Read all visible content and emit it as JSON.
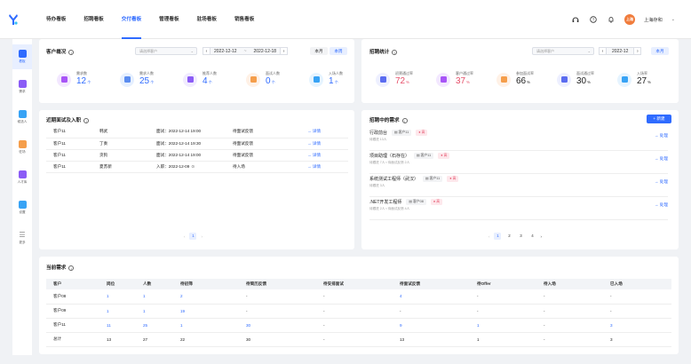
{
  "nav": {
    "tabs": [
      "待办看板",
      "招聘看板",
      "交付看板",
      "管理看板",
      "驻场看板",
      "销售看板"
    ],
    "active_index": 2,
    "user_avatar": "上海",
    "user_name": "上海存和"
  },
  "sidebar": {
    "items": [
      {
        "label": "看板",
        "color": "#2f6bff",
        "active": true
      },
      {
        "label": "需求",
        "color": "#8b5cf6"
      },
      {
        "label": "候选人",
        "color": "#38a3f5"
      },
      {
        "label": "驻场",
        "color": "#f59e4b"
      },
      {
        "label": "人才库",
        "color": "#8b5cf6"
      },
      {
        "label": "设置",
        "color": "#38a3f5"
      },
      {
        "label": "更多",
        "color": "#888"
      }
    ]
  },
  "customer_overview": {
    "title": "客户概况",
    "select_placeholder": "请选择客户",
    "date_start": "2022-12-12",
    "date_sep": "~",
    "date_end": "2022-12-18",
    "btn_month": "本月",
    "btn_week": "本周",
    "stats": [
      {
        "label": "需求数",
        "value": "12",
        "unit": "个",
        "icon_bg": "#f3e8ff",
        "icon_fg": "#a855f7"
      },
      {
        "label": "需求人数",
        "value": "25",
        "unit": "个",
        "icon_bg": "#e6f0ff",
        "icon_fg": "#5b8cf0"
      },
      {
        "label": "推荐人数",
        "value": "4",
        "unit": "个",
        "icon_bg": "#f1ecff",
        "icon_fg": "#8b5cf6"
      },
      {
        "label": "面试人数",
        "value": "0",
        "unit": "个",
        "icon_bg": "#fff1e6",
        "icon_fg": "#f59e4b"
      },
      {
        "label": "入场人数",
        "value": "1",
        "unit": "个",
        "icon_bg": "#e6f4ff",
        "icon_fg": "#38a3f5"
      }
    ]
  },
  "recruit_stats": {
    "title": "招聘统计",
    "select_placeholder": "请选择客户",
    "month": "2022-12",
    "btn_month": "本月",
    "stats": [
      {
        "label": "初筛通过率",
        "value": "72",
        "unit": "%",
        "style": "red",
        "icon_bg": "#eef0ff",
        "icon_fg": "#5b6cf0"
      },
      {
        "label": "客户通过率",
        "value": "37",
        "unit": "%",
        "style": "red",
        "icon_bg": "#f3e8ff",
        "icon_fg": "#a855f7"
      },
      {
        "label": "参加面试率",
        "value": "66",
        "unit": "%",
        "style": "dark",
        "icon_bg": "#fff1e6",
        "icon_fg": "#f59e4b"
      },
      {
        "label": "面试通过率",
        "value": "30",
        "unit": "%",
        "style": "dark",
        "icon_bg": "#eef0ff",
        "icon_fg": "#5b6cf0"
      },
      {
        "label": "入场率",
        "value": "27",
        "unit": "%",
        "style": "dark",
        "icon_bg": "#e6f4ff",
        "icon_fg": "#38a3f5"
      }
    ]
  },
  "recent": {
    "title": "近期面试及入职",
    "rows": [
      {
        "customer": "客户11",
        "name": "韩武",
        "event": "面试：2022-12-14 19:00",
        "status": "待面试反馈",
        "action": "详情"
      },
      {
        "customer": "客户11",
        "name": "丁奏",
        "event": "面试：2022-12-14 19:30",
        "status": "待面试反馈",
        "action": "详情"
      },
      {
        "customer": "客户11",
        "name": "贪狗",
        "event": "面试：2022-12-14 19:00",
        "status": "待面试反馈",
        "action": "详情"
      },
      {
        "customer": "客户11",
        "name": "夏苏新",
        "event": "入职：2022-12-09",
        "status": "待入场",
        "action": "详情"
      }
    ],
    "page": "1"
  },
  "hiring": {
    "title": "招聘中的需求",
    "add_label": "+ 新建",
    "items": [
      {
        "title": "行政前台",
        "customer": "客户11",
        "priority": "高",
        "sub": "待跟进 13人",
        "action": "处理"
      },
      {
        "title": "项目助理（石存在）",
        "customer": "客户11",
        "priority": "高",
        "sub": "待跟进 7人 ▪ 待面试反馈 2人",
        "action": "处理"
      },
      {
        "title": "系统测试工程师（武汉）",
        "customer": "客户11",
        "priority": "高",
        "sub": "待跟进 3人",
        "action": "处理"
      },
      {
        "title": ".NET开发工程师",
        "customer": "客户08",
        "priority": "高",
        "sub": "待跟进 2人 ▪ 待面试反馈 4人",
        "action": "处理"
      }
    ],
    "pages": [
      "1",
      "2",
      "3",
      "4"
    ]
  },
  "current": {
    "title": "当前需求",
    "headers": [
      "客户",
      "岗位",
      "人数",
      "待初筛",
      "待简历反馈",
      "待安排面试",
      "待面试反馈",
      "待Offer",
      "待入场",
      "已入场"
    ],
    "rows": [
      {
        "cells": [
          "客户08",
          "1",
          "1",
          "2",
          "-",
          "-",
          "4",
          "-",
          "-",
          "-"
        ],
        "links": [
          1,
          2,
          3,
          6
        ]
      },
      {
        "cells": [
          "客户09",
          "1",
          "1",
          "19",
          "-",
          "-",
          "-",
          "-",
          "-",
          "-"
        ],
        "links": [
          1,
          2,
          3
        ]
      },
      {
        "cells": [
          "客户11",
          "11",
          "25",
          "1",
          "30",
          "-",
          "9",
          "1",
          "-",
          "3"
        ],
        "links": [
          1,
          2,
          3,
          4,
          6,
          7,
          9
        ]
      },
      {
        "cells": [
          "总计",
          "13",
          "27",
          "22",
          "30",
          "-",
          "13",
          "1",
          "-",
          "3"
        ],
        "links": []
      }
    ]
  }
}
